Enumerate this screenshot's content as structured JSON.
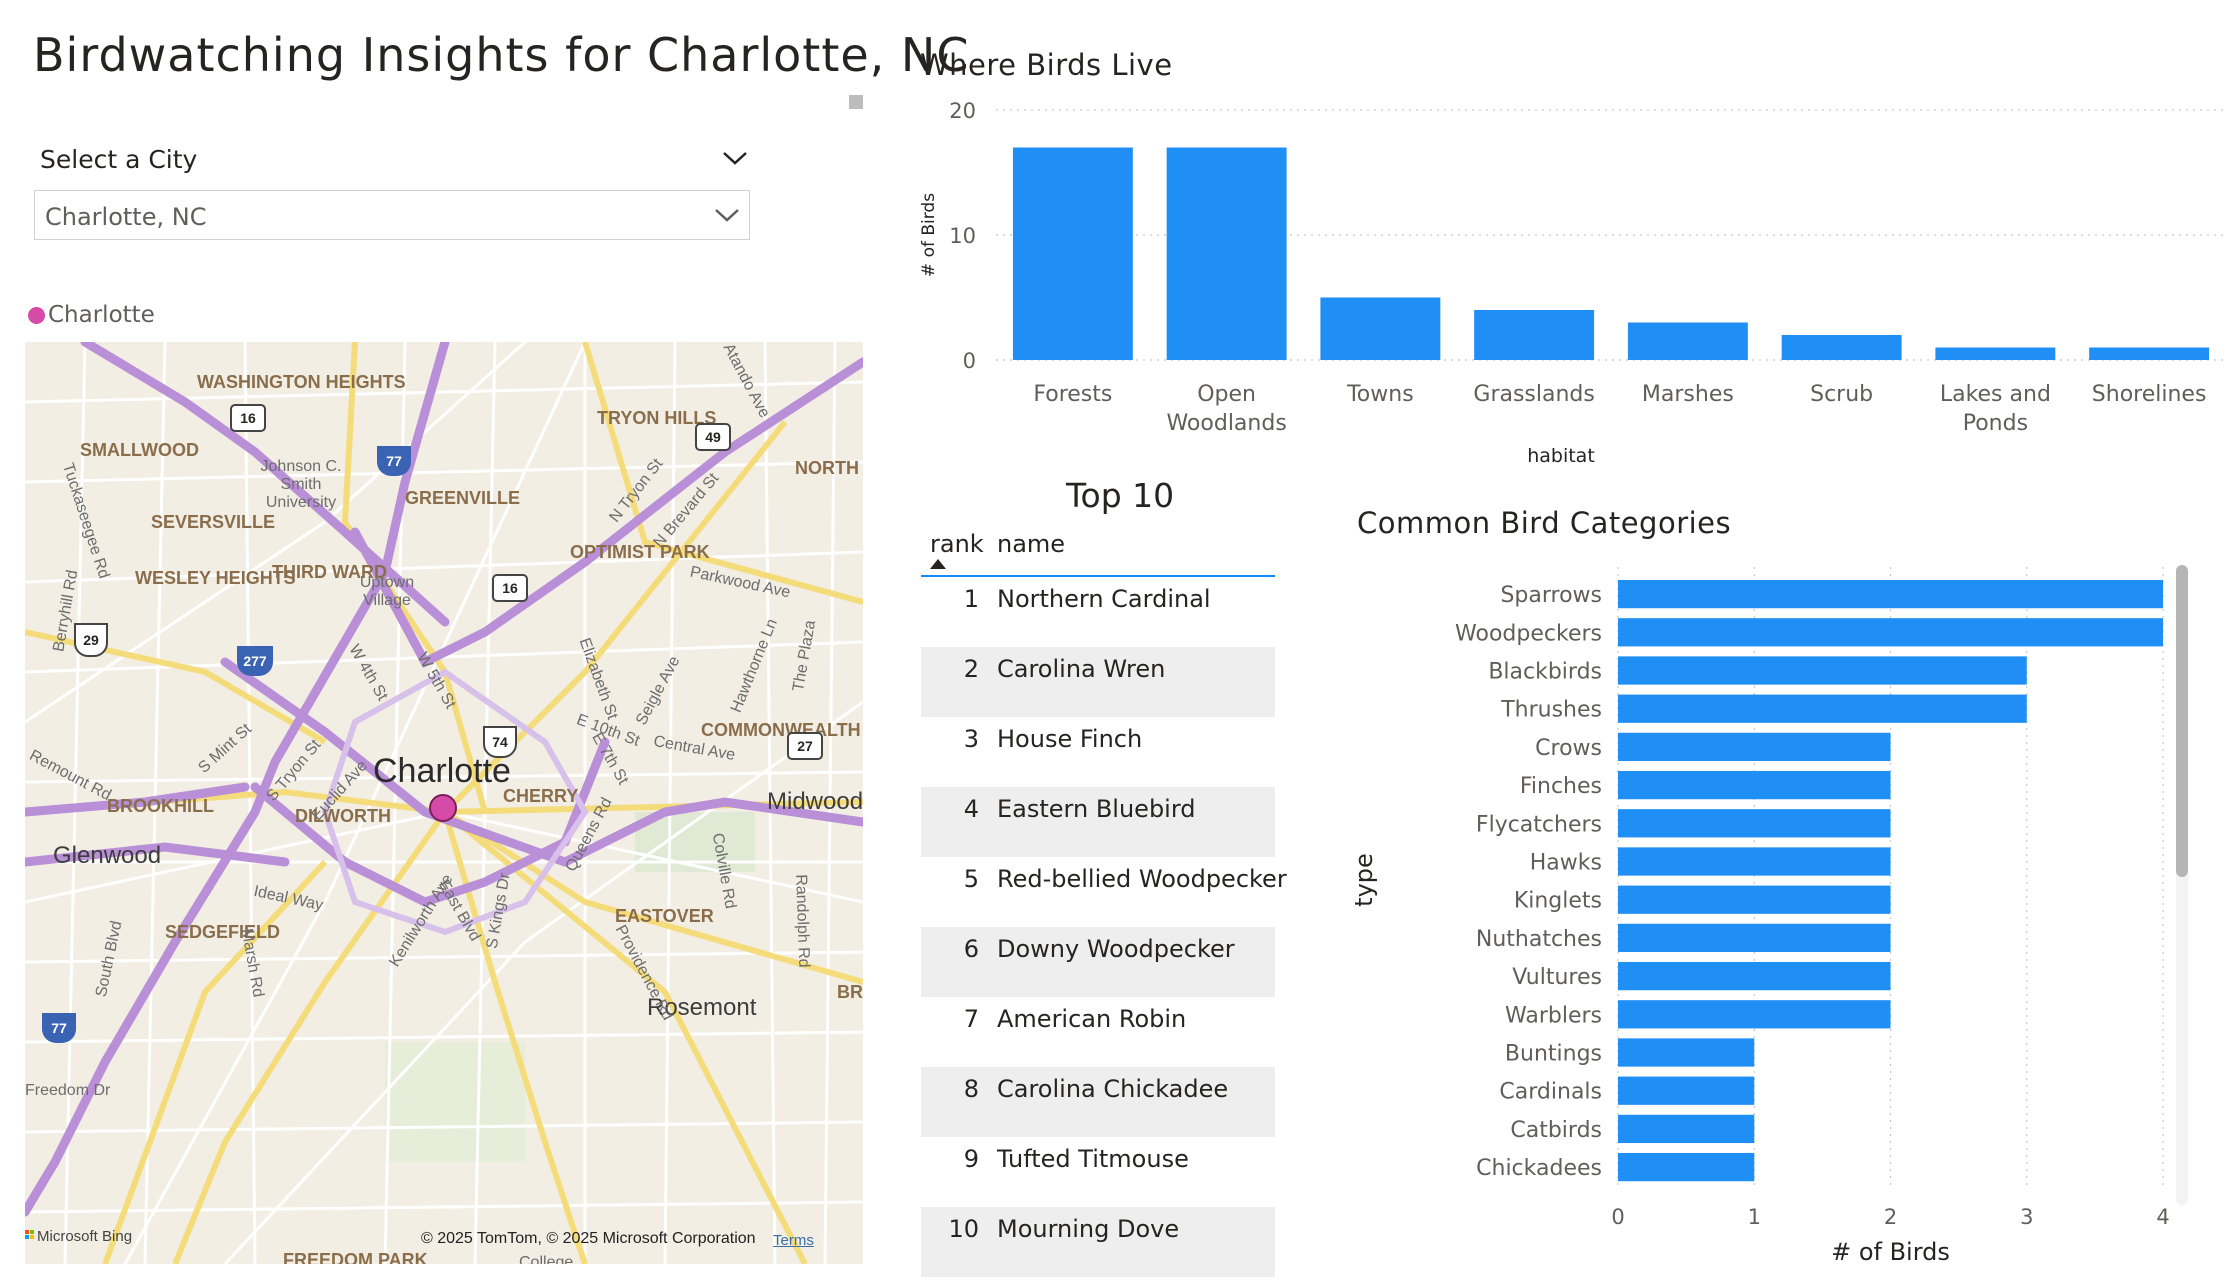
{
  "page_title": "Birdwatching Insights for Charlotte, NC",
  "slicer": {
    "label": "Select a City",
    "value": "Charlotte, NC"
  },
  "map": {
    "legend_label": "Charlotte",
    "legend_color": "#d64aa8",
    "city_label": "Charlotte",
    "districts": [
      "WASHINGTON HEIGHTS",
      "SMALLWOOD",
      "TRYON HILLS",
      "NORTH",
      "GREENVILLE",
      "SEVERSVILLE",
      "OPTIMIST PARK",
      "WESLEY HEIGHTS",
      "THIRD WARD",
      "COMMONWEALTH",
      "CHERRY",
      "BROOKHILL",
      "DILWORTH",
      "EASTOVER",
      "SEDGEFIELD",
      "FREEDOM PARK",
      "BRI"
    ],
    "places": [
      "Johnson C. Smith University",
      "Uptown Village",
      "Glenwood",
      "Midwood",
      "Rosemont",
      "College"
    ],
    "streets": [
      "Atando Ave",
      "N Tryon St",
      "N Brevard St",
      "Parkwood Ave",
      "The Plaza",
      "Hawthorne Ln",
      "Seigle Ave",
      "E 10th St",
      "Central Ave",
      "E 7th St",
      "Elizabeth St",
      "W 5th St",
      "W 4th St",
      "S Mint St",
      "S Tryon St",
      "Euclid Ave",
      "Queens Rd",
      "Kenilworth Ave",
      "S Kings Dr",
      "East Blvd",
      "Colville Rd",
      "Randolph Rd",
      "Providence Rd",
      "Ideal Way",
      "Marsh Rd",
      "South Blvd",
      "Berryhill Rd",
      "Freedom Dr",
      "Tuckaseegee Rd",
      "Remount Rd"
    ],
    "shields": [
      "77",
      "16",
      "49",
      "16",
      "29",
      "277",
      "74",
      "27",
      "77"
    ],
    "footer_bing": "Microsoft Bing",
    "footer_copyright": "© 2025 TomTom, © 2025 Microsoft Corporation",
    "footer_terms": "Terms"
  },
  "top10": {
    "title": "Top 10",
    "headers": {
      "rank": "rank",
      "name": "name"
    },
    "rows": [
      {
        "rank": "1",
        "name": "Northern Cardinal"
      },
      {
        "rank": "2",
        "name": "Carolina Wren"
      },
      {
        "rank": "3",
        "name": "House Finch"
      },
      {
        "rank": "4",
        "name": "Eastern Bluebird"
      },
      {
        "rank": "5",
        "name": "Red-bellied Woodpecker"
      },
      {
        "rank": "6",
        "name": "Downy Woodpecker"
      },
      {
        "rank": "7",
        "name": "American Robin"
      },
      {
        "rank": "8",
        "name": "Carolina Chickadee"
      },
      {
        "rank": "9",
        "name": "Tufted Titmouse"
      },
      {
        "rank": "10",
        "name": "Mourning Dove"
      }
    ]
  },
  "chart_data": [
    {
      "type": "bar",
      "title": "Where Birds Live",
      "xlabel": "habitat",
      "ylabel": "# of Birds",
      "categories": [
        "Forests",
        "Open Woodlands",
        "Towns",
        "Grasslands",
        "Marshes",
        "Scrub",
        "Lakes and Ponds",
        "Shorelines"
      ],
      "values": [
        17,
        17,
        5,
        4,
        3,
        2,
        1,
        1
      ],
      "ylim": [
        0,
        20
      ],
      "yticks": [
        0,
        10,
        20
      ],
      "color": "#1f8ff5",
      "grid": true
    },
    {
      "type": "bar",
      "orientation": "horizontal",
      "title": "Common Bird Categories",
      "xlabel": "# of Birds",
      "ylabel": "type",
      "categories": [
        "Sparrows",
        "Woodpeckers",
        "Blackbirds",
        "Thrushes",
        "Crows",
        "Finches",
        "Flycatchers",
        "Hawks",
        "Kinglets",
        "Nuthatches",
        "Vultures",
        "Warblers",
        "Buntings",
        "Cardinals",
        "Catbirds",
        "Chickadees"
      ],
      "values": [
        4,
        4,
        3,
        3,
        2,
        2,
        2,
        2,
        2,
        2,
        2,
        2,
        1,
        1,
        1,
        1
      ],
      "xlim": [
        0,
        4
      ],
      "xticks": [
        0,
        1,
        2,
        3,
        4
      ],
      "color": "#1f8ff5",
      "grid": true
    }
  ]
}
